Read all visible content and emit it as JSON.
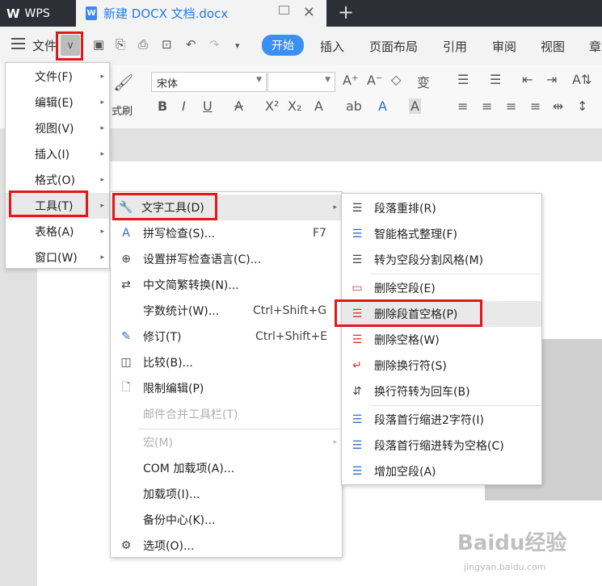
{
  "titlebar": {
    "app_name": "WPS",
    "doc_tab": "新建 DOCX 文档.docx",
    "new_tab": "+"
  },
  "menubar": {
    "file_label": "文件",
    "tabs": [
      "开始",
      "插入",
      "页面布局",
      "引用",
      "审阅",
      "视图",
      "章"
    ]
  },
  "toolbar": {
    "font_name": "宋体",
    "brush_label": "式刷"
  },
  "file_menu": {
    "items": [
      {
        "label": "文件(F)"
      },
      {
        "label": "编辑(E)"
      },
      {
        "label": "视图(V)"
      },
      {
        "label": "插入(I)"
      },
      {
        "label": "格式(O)"
      },
      {
        "label": "工具(T)"
      },
      {
        "label": "表格(A)"
      },
      {
        "label": "窗口(W)"
      }
    ]
  },
  "tools_menu": {
    "items": [
      {
        "label": "文字工具(D)",
        "shortcut": ""
      },
      {
        "label": "拼写检查(S)...",
        "shortcut": "F7"
      },
      {
        "label": "设置拼写检查语言(C)...",
        "shortcut": ""
      },
      {
        "label": "中文简繁转换(N)...",
        "shortcut": ""
      },
      {
        "label": "字数统计(W)...",
        "shortcut": "Ctrl+Shift+G"
      },
      {
        "label": "修订(T)",
        "shortcut": "Ctrl+Shift+E"
      },
      {
        "label": "比较(B)...",
        "shortcut": ""
      },
      {
        "label": "限制编辑(P)",
        "shortcut": ""
      },
      {
        "label": "邮件合并工具栏(T)",
        "shortcut": ""
      },
      {
        "label": "宏(M)",
        "shortcut": ""
      },
      {
        "label": "COM 加载项(A)...",
        "shortcut": ""
      },
      {
        "label": "加载项(I)...",
        "shortcut": ""
      },
      {
        "label": "备份中心(K)...",
        "shortcut": ""
      },
      {
        "label": "选项(O)...",
        "shortcut": ""
      }
    ]
  },
  "text_tools_menu": {
    "items": [
      {
        "label": "段落重排(R)"
      },
      {
        "label": "智能格式整理(F)"
      },
      {
        "label": "转为空段分割风格(M)"
      },
      {
        "label": "删除空段(E)"
      },
      {
        "label": "删除段首空格(P)"
      },
      {
        "label": "删除空格(W)"
      },
      {
        "label": "删除换行符(S)"
      },
      {
        "label": "换行符转为回车(B)"
      },
      {
        "label": "段落首行缩进2字符(I)"
      },
      {
        "label": "段落首行缩进转为空格(C)"
      },
      {
        "label": "增加空段(A)"
      }
    ]
  },
  "watermark": {
    "brand": "Baidu经验",
    "url": "jingyan.baidu.com"
  }
}
